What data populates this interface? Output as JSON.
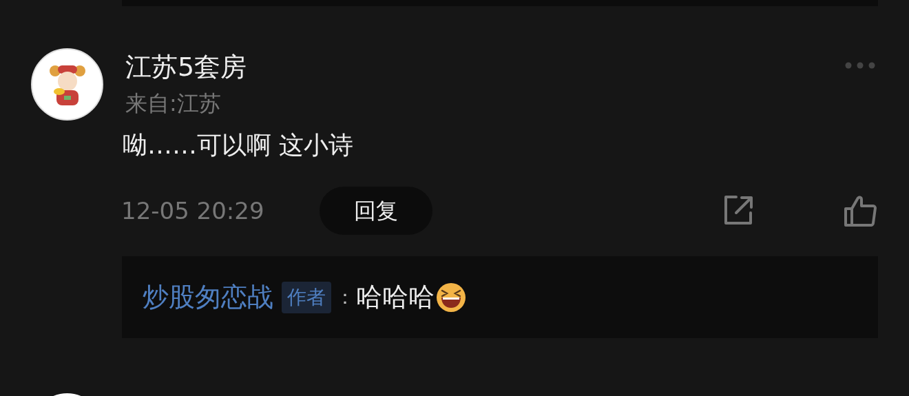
{
  "comment": {
    "username": "江苏5套房",
    "location": "来自:江苏",
    "content": "呦……可以啊 这小诗",
    "time": "12-05 20:29",
    "reply_button": "回复"
  },
  "replies": [
    {
      "author": "炒股匆恋战",
      "badge": "作者",
      "separator": "：",
      "text": "哈哈哈"
    }
  ]
}
